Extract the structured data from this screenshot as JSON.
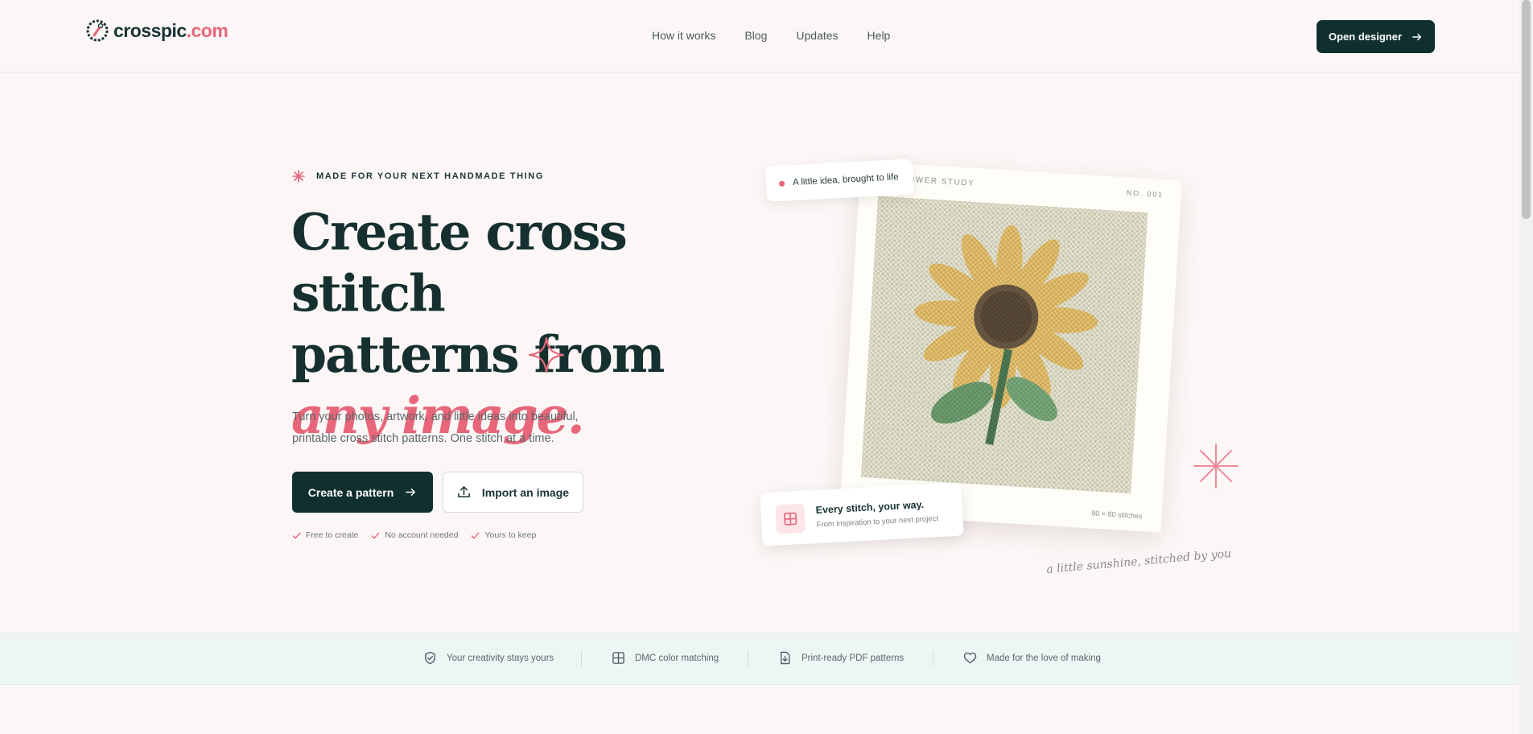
{
  "brand": {
    "name": "crosspic",
    "tld": ".com",
    "accent": "#e8667a",
    "dark": "#10302f"
  },
  "nav": {
    "items": [
      "How it works",
      "Blog",
      "Updates",
      "Help"
    ]
  },
  "header": {
    "cta_label": "Open designer"
  },
  "hero": {
    "eyebrow": "MADE FOR YOUR NEXT HANDMADE THING",
    "title_line1": "Create cross stitch",
    "title_line2": "patterns from",
    "title_accent": "any image.",
    "description": "Turn your photos, artwork, and little ideas into beautiful, printable cross stitch patterns. One stitch at a time.",
    "primary_label": "Create a pattern",
    "secondary_label": "Import an image",
    "checks": [
      "Free to create",
      "No account needed",
      "Yours to keep"
    ]
  },
  "showcase": {
    "pill_text": "A little idea, brought to life",
    "frame_label": "OWER STUDY",
    "frame_number": "NO. 001",
    "stitch_count": "80 × 80 stitches",
    "note_title": "Every stitch, your way.",
    "note_subtitle": "From inspiration to your next project",
    "caption": "a little sunshine, stitched by you"
  },
  "features": [
    {
      "icon": "shield-check-icon",
      "label": "Your creativity stays yours"
    },
    {
      "icon": "grid-icon",
      "label": "DMC color matching"
    },
    {
      "icon": "file-download-icon",
      "label": "Print-ready PDF patterns"
    },
    {
      "icon": "heart-icon",
      "label": "Made for the love of making"
    }
  ]
}
